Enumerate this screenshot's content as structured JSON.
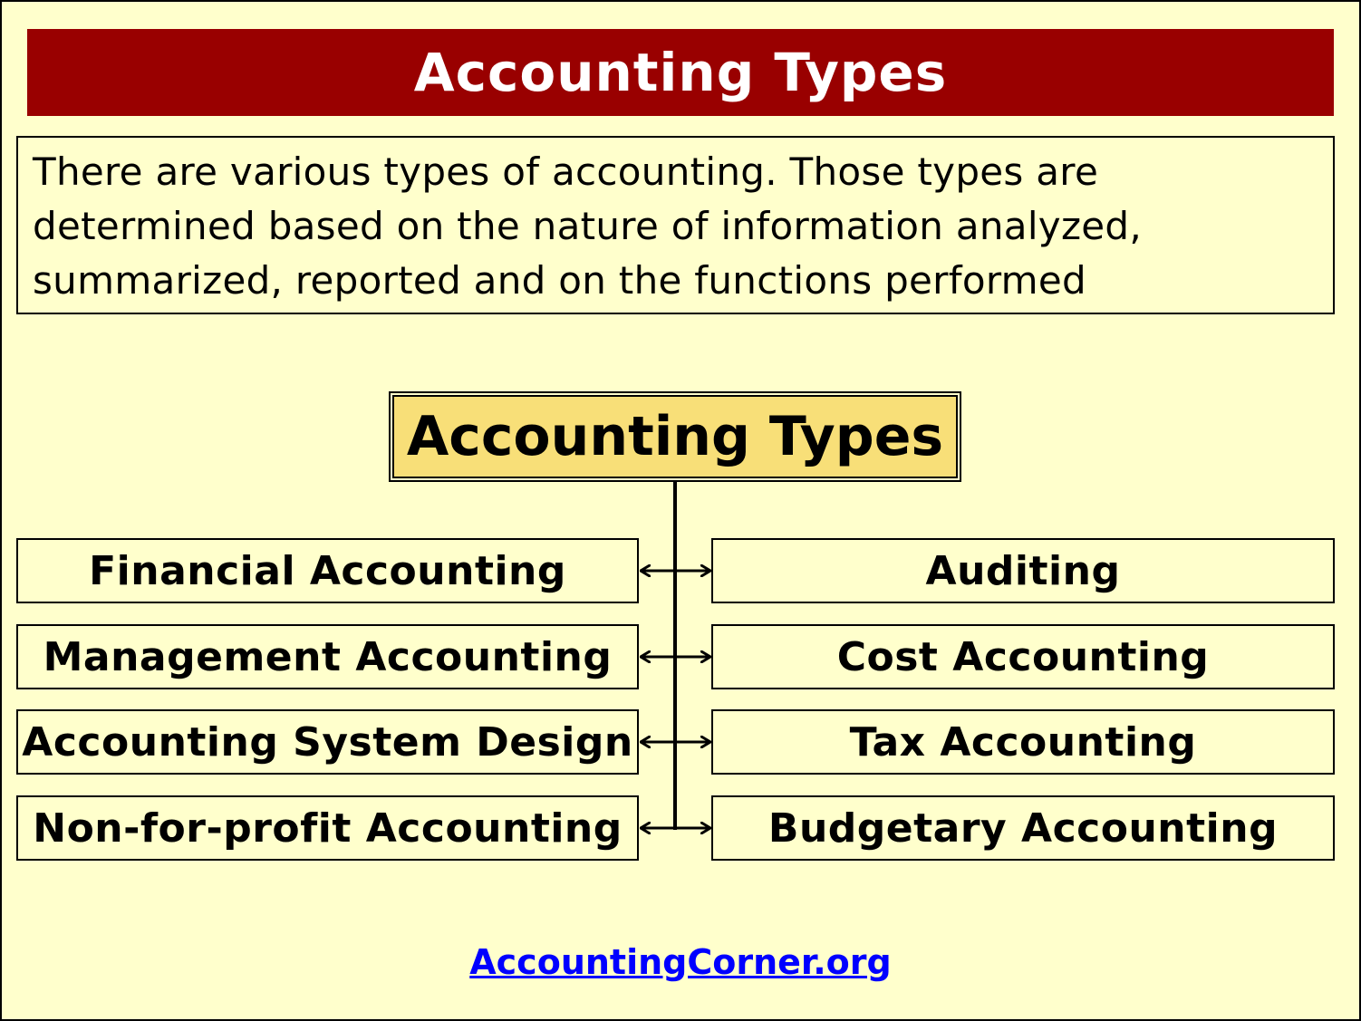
{
  "title": "Accounting Types",
  "intro_text": "There are various types of accounting. Those types are determined based on the nature of information analyzed, summarized, reported and on the functions performed",
  "diagram": {
    "central_label": "Accounting Types",
    "left_types": [
      "Financial Accounting",
      "Management Accounting",
      "Accounting System Design",
      "Non-for-profit Accounting"
    ],
    "right_types": [
      "Auditing",
      "Cost Accounting",
      "Tax Accounting",
      "Budgetary Accounting"
    ]
  },
  "footer": {
    "link_text": "AccountingCorner.org"
  },
  "colors": {
    "background": "#FFFFCC",
    "title_bar": "#990000",
    "central_box": "#F8DF78",
    "link": "#0000FF"
  }
}
